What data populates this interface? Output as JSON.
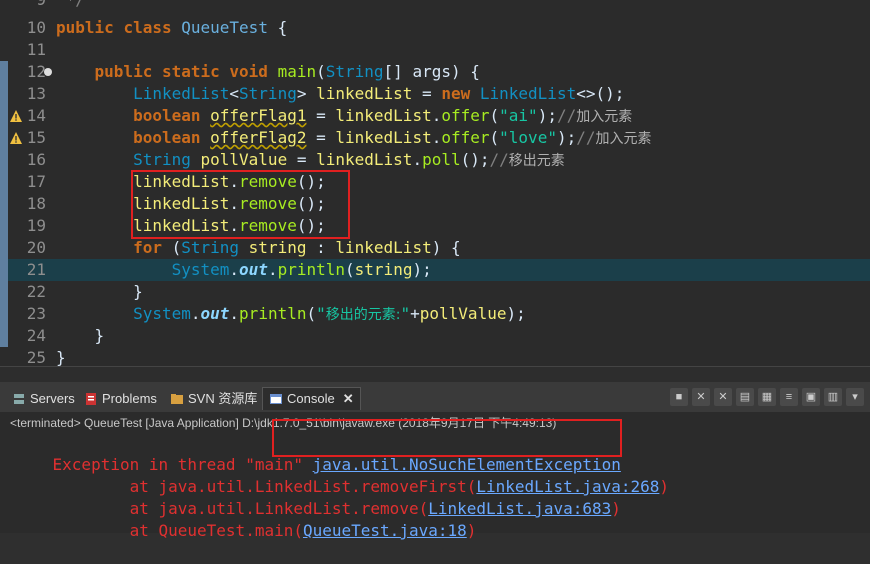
{
  "editor": {
    "lines": [
      {
        "n": "9",
        "code": " */"
      },
      {
        "n": "10",
        "code": "public class QueueTest {"
      },
      {
        "n": "11",
        "code": ""
      },
      {
        "n": "12",
        "code": "    public static void main(String[] args) {"
      },
      {
        "n": "13",
        "code": "        LinkedList<String> linkedList = new LinkedList<>();"
      },
      {
        "n": "14",
        "code": "        boolean offerFlag1 = linkedList.offer(\"ai\");//加入元素"
      },
      {
        "n": "15",
        "code": "        boolean offerFlag2 = linkedList.offer(\"love\");//加入元素"
      },
      {
        "n": "16",
        "code": "        String pollValue = linkedList.poll();//移出元素"
      },
      {
        "n": "17",
        "code": "        linkedList.remove();"
      },
      {
        "n": "18",
        "code": "        linkedList.remove();"
      },
      {
        "n": "19",
        "code": "        linkedList.remove();"
      },
      {
        "n": "20",
        "code": "        for (String string : linkedList) {"
      },
      {
        "n": "21",
        "code": "            System.out.println(string);"
      },
      {
        "n": "22",
        "code": "        }"
      },
      {
        "n": "23",
        "code": "        System.out.println(\"移出的元素:\"+pollValue);"
      },
      {
        "n": "24",
        "code": "    }"
      },
      {
        "n": "25",
        "code": "}"
      }
    ]
  },
  "tabs": {
    "servers": "Servers",
    "problems": "Problems",
    "svn": "SVN 资源库",
    "console": "Console"
  },
  "console": {
    "status": "<terminated> QueueTest [Java Application] D:\\jdk1.7.0_51\\bin\\javaw.exe (2018年9月17日 下午4:49:13)",
    "exception_prefix": "Exception in thread \"main\" ",
    "exception_link": "java.util.NoSuchElementException",
    "trace": [
      {
        "prefix": "        at java.util.LinkedList.removeFirst(",
        "link": "LinkedList.java:268",
        "suffix": ")"
      },
      {
        "prefix": "        at java.util.LinkedList.remove(",
        "link": "LinkedList.java:683",
        "suffix": ")"
      },
      {
        "prefix": "        at QueueTest.main(",
        "link": "QueueTest.java:18",
        "suffix": ")"
      }
    ]
  },
  "colors": {
    "highlight_line": "#1b3f4a",
    "error_text": "#e03030",
    "annotation_box": "#e02020"
  }
}
